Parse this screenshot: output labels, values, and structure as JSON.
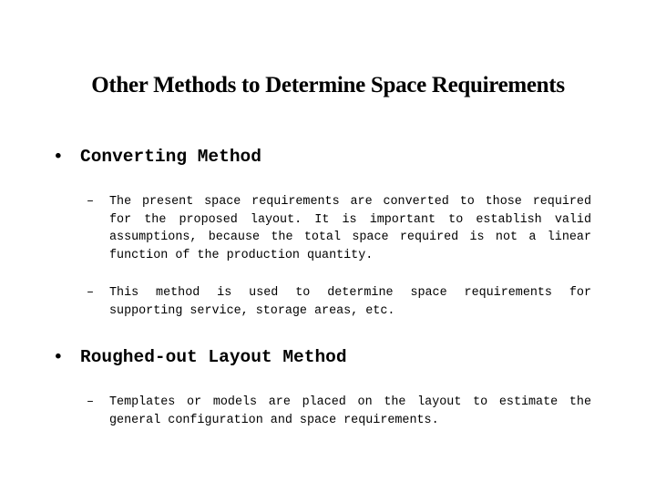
{
  "slide": {
    "title": "Other Methods to Determine Space Requirements",
    "sections": [
      {
        "bullet_symbol": "•",
        "heading": "Converting Method",
        "items": [
          {
            "dash": "–",
            "text": "The present space requirements are converted to those required for the proposed layout. It is important to establish valid assumptions, because the total space required is not a linear function of the production quantity."
          },
          {
            "dash": "–",
            "text": "This method is used to determine space requirements for supporting service, storage areas, etc."
          }
        ]
      },
      {
        "bullet_symbol": "•",
        "heading": "Roughed-out Layout Method",
        "items": [
          {
            "dash": "–",
            "text": "Templates or models are placed on the layout to estimate the general configuration and space requirements."
          }
        ]
      }
    ]
  }
}
